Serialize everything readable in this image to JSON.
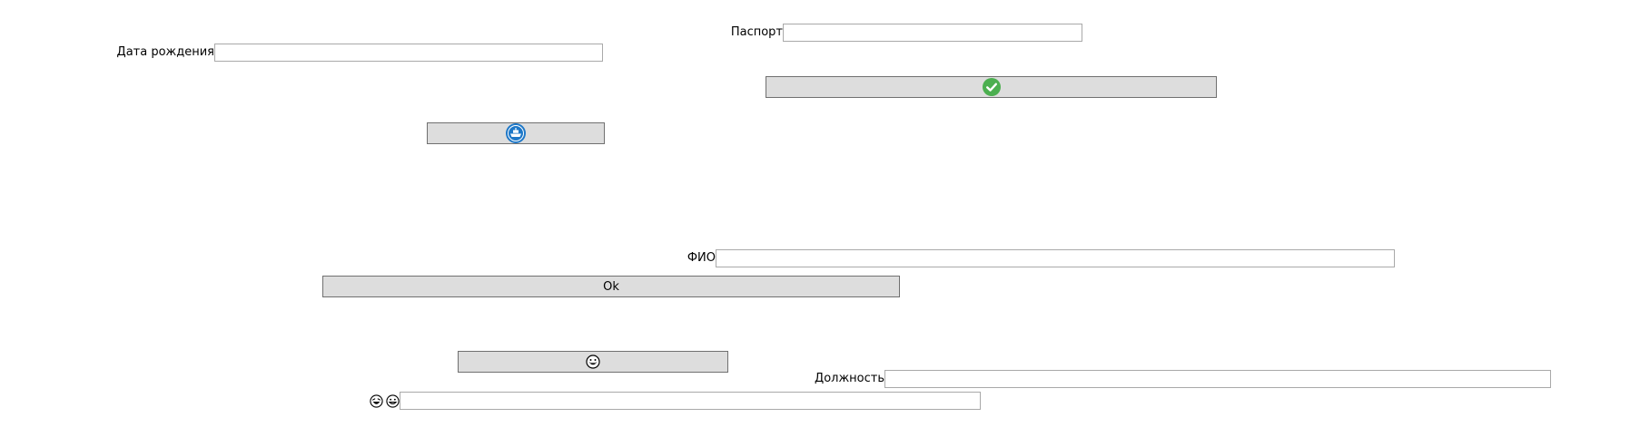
{
  "form": {
    "passport": {
      "label": "Паспорт",
      "value": ""
    },
    "birth_date": {
      "label": "Дата рождения",
      "value": ""
    },
    "full_name": {
      "label": "ФИО",
      "value": ""
    },
    "position": {
      "label": "Должность",
      "value": ""
    },
    "emoji_field": {
      "value": ""
    }
  },
  "buttons": {
    "check": {
      "icon": "green-check-circle-icon",
      "color": "#4caf50"
    },
    "badge": {
      "icon": "blue-emblem-icon",
      "color": "#1e78c8"
    },
    "ok": {
      "label": "Ok"
    },
    "emoji": {
      "icon": "masked-face-emoji-icon"
    }
  },
  "emoji_label": {
    "icons": [
      "laughing-face-emoji-icon",
      "grinning-face-emoji-icon"
    ]
  },
  "colors": {
    "button_bg": "#dddddd",
    "button_border": "#707070",
    "input_border": "#a9a9a9"
  }
}
